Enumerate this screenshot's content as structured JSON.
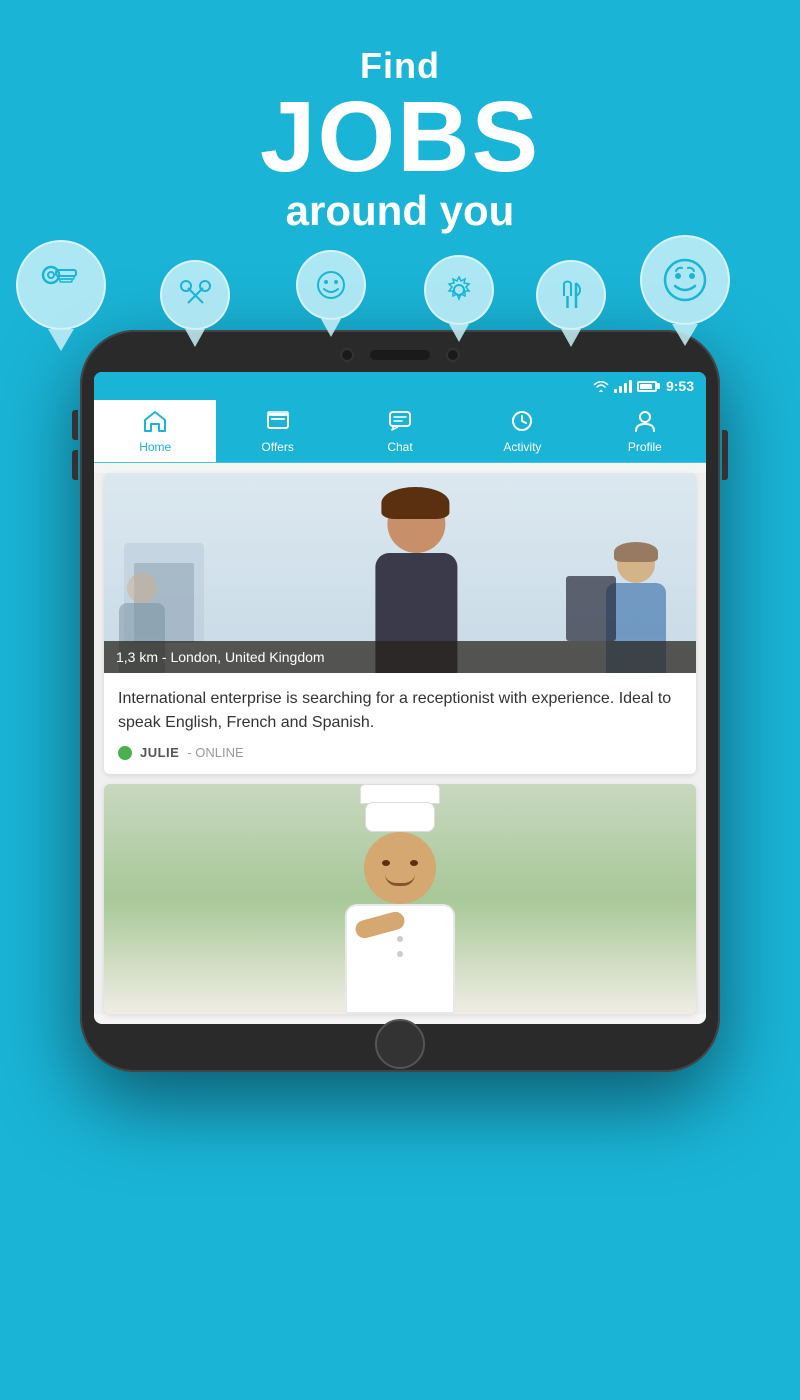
{
  "header": {
    "find_label": "Find",
    "jobs_label": "JOBS",
    "around_label": "around you"
  },
  "status_bar": {
    "time": "9:53"
  },
  "nav": {
    "items": [
      {
        "id": "home",
        "label": "Home",
        "icon": "🏠",
        "active": true
      },
      {
        "id": "offers",
        "label": "Offers",
        "icon": "◈",
        "active": false
      },
      {
        "id": "chat",
        "label": "Chat",
        "icon": "💬",
        "active": false
      },
      {
        "id": "activity",
        "label": "Activity",
        "icon": "⏱",
        "active": false
      },
      {
        "id": "profile",
        "label": "Profile",
        "icon": "👤",
        "active": false
      }
    ]
  },
  "job_cards": [
    {
      "location": "1,3 km - London, United Kingdom",
      "description": "International enterprise is searching for a receptionist with experience. Ideal to speak English, French and Spanish.",
      "recruiter_name": "JULIE",
      "recruiter_status": "- ONLINE"
    }
  ],
  "pins": [
    {
      "icon": "🔧",
      "size": "large",
      "left": "2%"
    },
    {
      "icon": "✂️",
      "size": "normal",
      "left": "18%"
    },
    {
      "icon": "😊",
      "size": "normal",
      "left": "34%"
    },
    {
      "icon": "🔩",
      "size": "normal",
      "left": "50%"
    },
    {
      "icon": "✂️",
      "size": "normal",
      "left": "64%"
    },
    {
      "icon": "😊",
      "size": "large",
      "left": "78%"
    }
  ]
}
